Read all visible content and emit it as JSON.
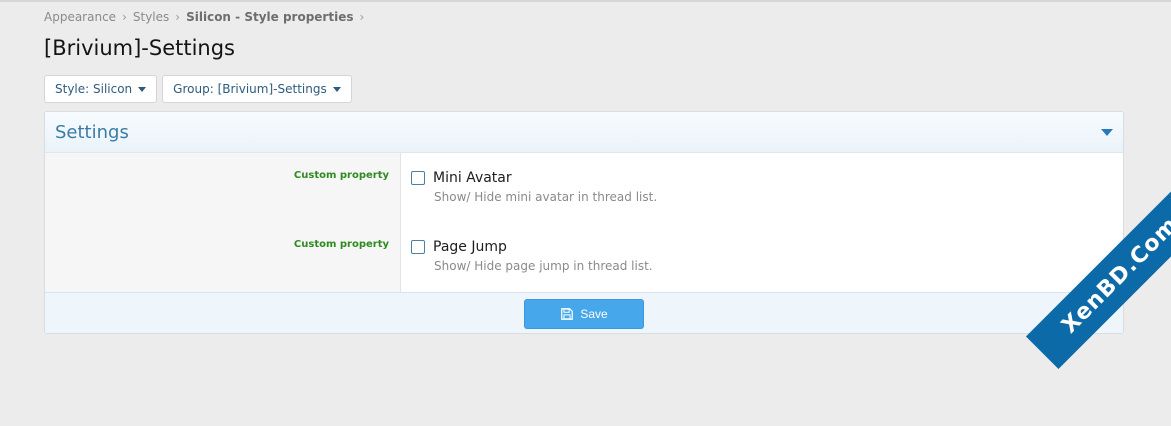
{
  "breadcrumb": {
    "items": [
      "Appearance",
      "Styles",
      "Silicon - Style properties"
    ],
    "separator": "›"
  },
  "page": {
    "title": "[Brivium]-Settings"
  },
  "filters": {
    "style_label": "Style: Silicon",
    "group_label": "Group: [Brivium]-Settings"
  },
  "panel": {
    "title": "Settings",
    "rows": [
      {
        "property_label": "Custom property",
        "option_label": "Mini Avatar",
        "hint": "Show/ Hide mini avatar in thread list.",
        "checked": false
      },
      {
        "property_label": "Custom property",
        "option_label": "Page Jump",
        "hint": "Show/ Hide page jump in thread list.",
        "checked": false
      }
    ],
    "save_label": "Save"
  },
  "watermark": {
    "text": "XenBD.Com"
  },
  "colors": {
    "accent": "#47a7eb",
    "link": "#2d5b7d",
    "panel_title": "#3a7ca5",
    "property_label": "#2e8b20",
    "watermark_bg": "#0d6aa8"
  }
}
